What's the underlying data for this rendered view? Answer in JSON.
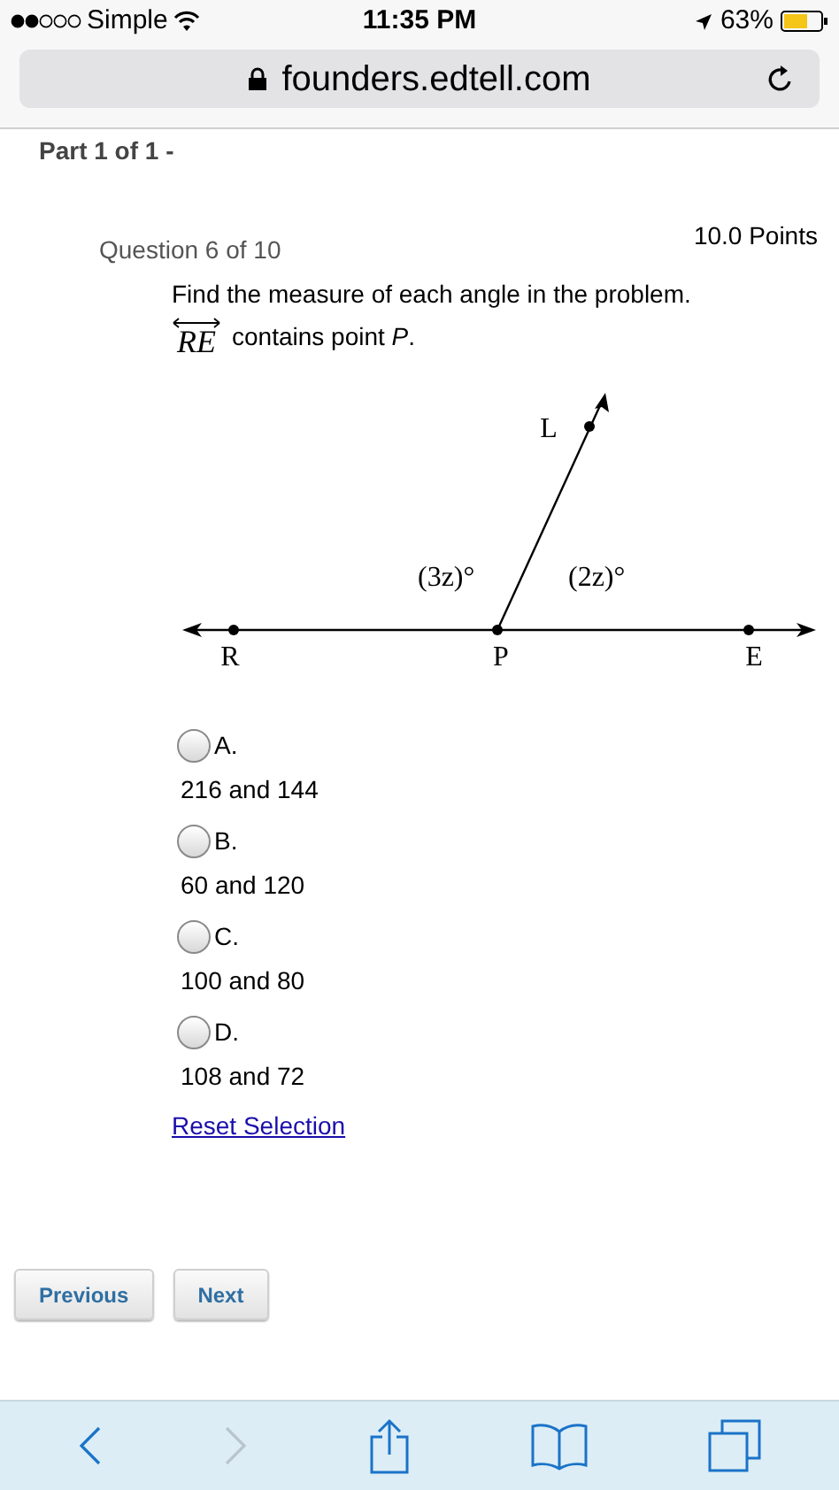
{
  "status_bar": {
    "carrier": "Simple",
    "time": "11:35 PM",
    "battery": "63%"
  },
  "address_bar": {
    "url": "founders.edtell.com"
  },
  "part_heading": "Part 1 of 1 -",
  "question": {
    "number": "Question 6 of 10",
    "points": "10.0 Points",
    "prompt": "Find the measure of each angle in the problem.",
    "line_name": "RE",
    "statement": "contains point *P*."
  },
  "diagram": {
    "point_labels": [
      "L",
      "R",
      "P",
      "E"
    ],
    "angle_labels": [
      "(3z)°",
      "(2z)°"
    ]
  },
  "options": [
    {
      "letter": "A.",
      "answer": "216 and 144",
      "selected": false
    },
    {
      "letter": "B.",
      "answer": "60 and 120",
      "selected": false
    },
    {
      "letter": "C.",
      "answer": "100 and 80",
      "selected": false
    },
    {
      "letter": "D.",
      "answer": "108 and 72",
      "selected": false
    }
  ],
  "reset_link": "Reset Selection",
  "nav_buttons": [
    "Previous",
    "Next"
  ]
}
